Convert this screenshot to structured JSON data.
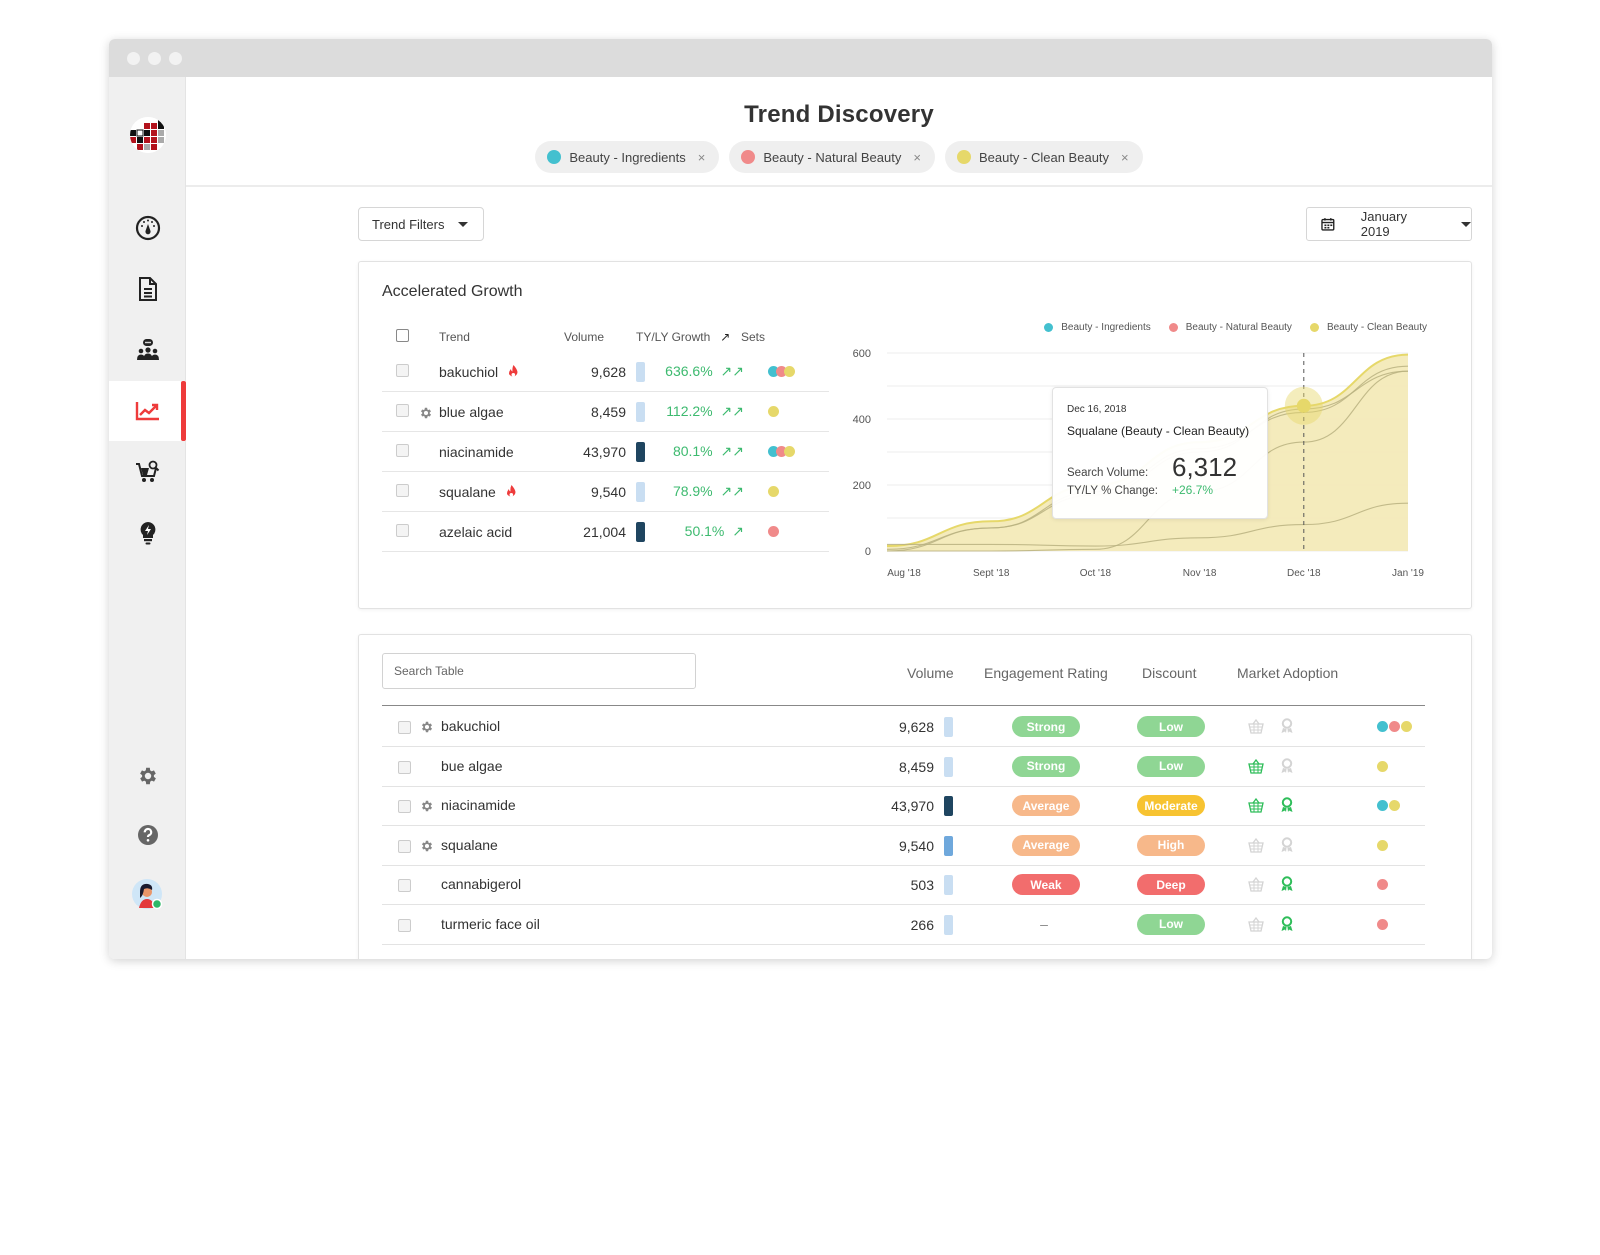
{
  "app": {
    "title": "Trend Discovery",
    "colors": {
      "ingredients": "#43c0cf",
      "natural": "#f08a8a",
      "clean": "#e6d86a",
      "accent": "#ee3b3b",
      "green": "#3dba6f"
    }
  },
  "sidebar": {
    "logo": "brand-logo",
    "items": [
      {
        "name": "dashboard",
        "icon": "gauge-icon",
        "active": false
      },
      {
        "name": "reports",
        "icon": "document-icon",
        "active": false
      },
      {
        "name": "community",
        "icon": "people-chat-icon",
        "active": false
      },
      {
        "name": "trends",
        "icon": "trend-chart-icon",
        "active": true
      },
      {
        "name": "shopping",
        "icon": "cart-search-icon",
        "active": false
      },
      {
        "name": "insights",
        "icon": "lightbulb-icon",
        "active": false
      }
    ],
    "bottom": [
      {
        "name": "settings",
        "icon": "gear-icon"
      },
      {
        "name": "help",
        "icon": "help-icon"
      },
      {
        "name": "profile",
        "icon": "avatar",
        "status": "online"
      }
    ]
  },
  "header": {
    "chips": [
      {
        "label": "Beauty - Ingredients",
        "color": "#43c0cf"
      },
      {
        "label": "Beauty - Natural Beauty",
        "color": "#f08a8a"
      },
      {
        "label": "Beauty - Clean Beauty",
        "color": "#e6d86a"
      }
    ],
    "chip_close": "×"
  },
  "toolbar": {
    "filters_label": "Trend Filters",
    "date_label": "January 2019"
  },
  "accelerated": {
    "title": "Accelerated Growth",
    "columns": [
      "Trend",
      "Volume",
      "TY/LY Growth",
      "Sets"
    ],
    "growth_sort_icon": "↗",
    "rows": [
      {
        "trend": "bakuchiol",
        "badge": "fire",
        "volume": "9,628",
        "bar": "light",
        "growth": "636.6%",
        "arrows": "↗↗",
        "sets": [
          "#43c0cf",
          "#f08a8a",
          "#e6d86a"
        ]
      },
      {
        "trend": "blue algae",
        "badge": "gear",
        "volume": "8,459",
        "bar": "light",
        "growth": "112.2%",
        "arrows": "↗↗",
        "sets": [
          "#e6d86a"
        ]
      },
      {
        "trend": "niacinamide",
        "badge": "",
        "volume": "43,970",
        "bar": "dark",
        "growth": "80.1%",
        "arrows": "↗↗",
        "sets": [
          "#43c0cf",
          "#f08a8a",
          "#e6d86a"
        ]
      },
      {
        "trend": "squalane",
        "badge": "fire",
        "volume": "9,540",
        "bar": "light",
        "growth": "78.9%",
        "arrows": "↗↗",
        "sets": [
          "#e6d86a"
        ]
      },
      {
        "trend": "azelaic acid",
        "badge": "",
        "volume": "21,004",
        "bar": "dark",
        "growth": "50.1%",
        "arrows": "↗",
        "sets": [
          "#f08a8a"
        ]
      }
    ]
  },
  "chart_data": {
    "type": "area",
    "title": "",
    "xlabel": "",
    "ylabel": "",
    "ylim": [
      0,
      600
    ],
    "yticks": [
      "0",
      "200",
      "400",
      "600"
    ],
    "x": [
      "Aug '18",
      "Sept '18",
      "Oct '18",
      "Nov '18",
      "Dec '18",
      "Jan '19"
    ],
    "legend": [
      "Beauty - Ingredients",
      "Beauty - Natural Beauty",
      "Beauty - Clean Beauty"
    ],
    "legend_position": "top-right",
    "grid": true,
    "series": [
      {
        "name": "Beauty - Clean Beauty (area)",
        "color": "#e6d86a",
        "values": [
          15,
          90,
          200,
          330,
          440,
          595
        ]
      },
      {
        "name": "trend line 2",
        "color": "#b8b280",
        "values": [
          5,
          70,
          180,
          310,
          420,
          560
        ]
      },
      {
        "name": "trend line 3",
        "color": "#b8b280",
        "values": [
          -10,
          70,
          170,
          300,
          430,
          545
        ]
      },
      {
        "name": "trend line 4",
        "color": "#b8b280",
        "values": [
          0,
          0,
          5,
          180,
          330,
          545
        ]
      },
      {
        "name": "trend line 5",
        "color": "#b8b280",
        "values": [
          20,
          20,
          15,
          40,
          80,
          145
        ]
      }
    ],
    "hover_x_index": 4.0,
    "tooltip": {
      "date": "Dec 16, 2018",
      "title": "Squalane (Beauty - Clean Beauty)",
      "volume_label": "Search Volume:",
      "volume": "6,312",
      "change_label": "TY/LY % Change:",
      "change": "+26.7%"
    }
  },
  "table": {
    "search_placeholder": "Search Table",
    "columns": [
      "Volume",
      "Engagement Rating",
      "Discount",
      "Market Adoption"
    ],
    "rows": [
      {
        "trend": "bakuchiol",
        "gear": true,
        "volume": "9,628",
        "bar": "light",
        "engagement": "Strong",
        "eng_color": "#8fd694",
        "discount": "Low",
        "disc_color": "#8fd694",
        "basket": false,
        "award": false,
        "sets": [
          "#43c0cf",
          "#f08a8a",
          "#e6d86a"
        ]
      },
      {
        "trend": "bue algae",
        "gear": false,
        "volume": "8,459",
        "bar": "light",
        "engagement": "Strong",
        "eng_color": "#8fd694",
        "discount": "Low",
        "disc_color": "#8fd694",
        "basket": true,
        "award": false,
        "sets": [
          "#e6d86a"
        ]
      },
      {
        "trend": "niacinamide",
        "gear": true,
        "volume": "43,970",
        "bar": "dark",
        "engagement": "Average",
        "eng_color": "#f7b88a",
        "discount": "Moderate",
        "disc_color": "#f7c331",
        "basket": true,
        "award": true,
        "sets": [
          "#43c0cf",
          "#e6d86a"
        ]
      },
      {
        "trend": "squalane",
        "gear": true,
        "volume": "9,540",
        "bar": "mid",
        "engagement": "Average",
        "eng_color": "#f7b88a",
        "discount": "High",
        "disc_color": "#f7b88a",
        "basket": false,
        "award": false,
        "sets": [
          "#e6d86a"
        ]
      },
      {
        "trend": "cannabigerol",
        "gear": false,
        "volume": "503",
        "bar": "light",
        "engagement": "Weak",
        "eng_color": "#f26d6d",
        "discount": "Deep",
        "disc_color": "#f26d6d",
        "basket": false,
        "award": true,
        "sets": [
          "#f08a8a"
        ]
      },
      {
        "trend": "turmeric face oil",
        "gear": false,
        "volume": "266",
        "bar": "light",
        "engagement": "–",
        "eng_color": "",
        "discount": "Low",
        "disc_color": "#8fd694",
        "basket": false,
        "award": true,
        "sets": [
          "#f08a8a"
        ]
      }
    ]
  }
}
